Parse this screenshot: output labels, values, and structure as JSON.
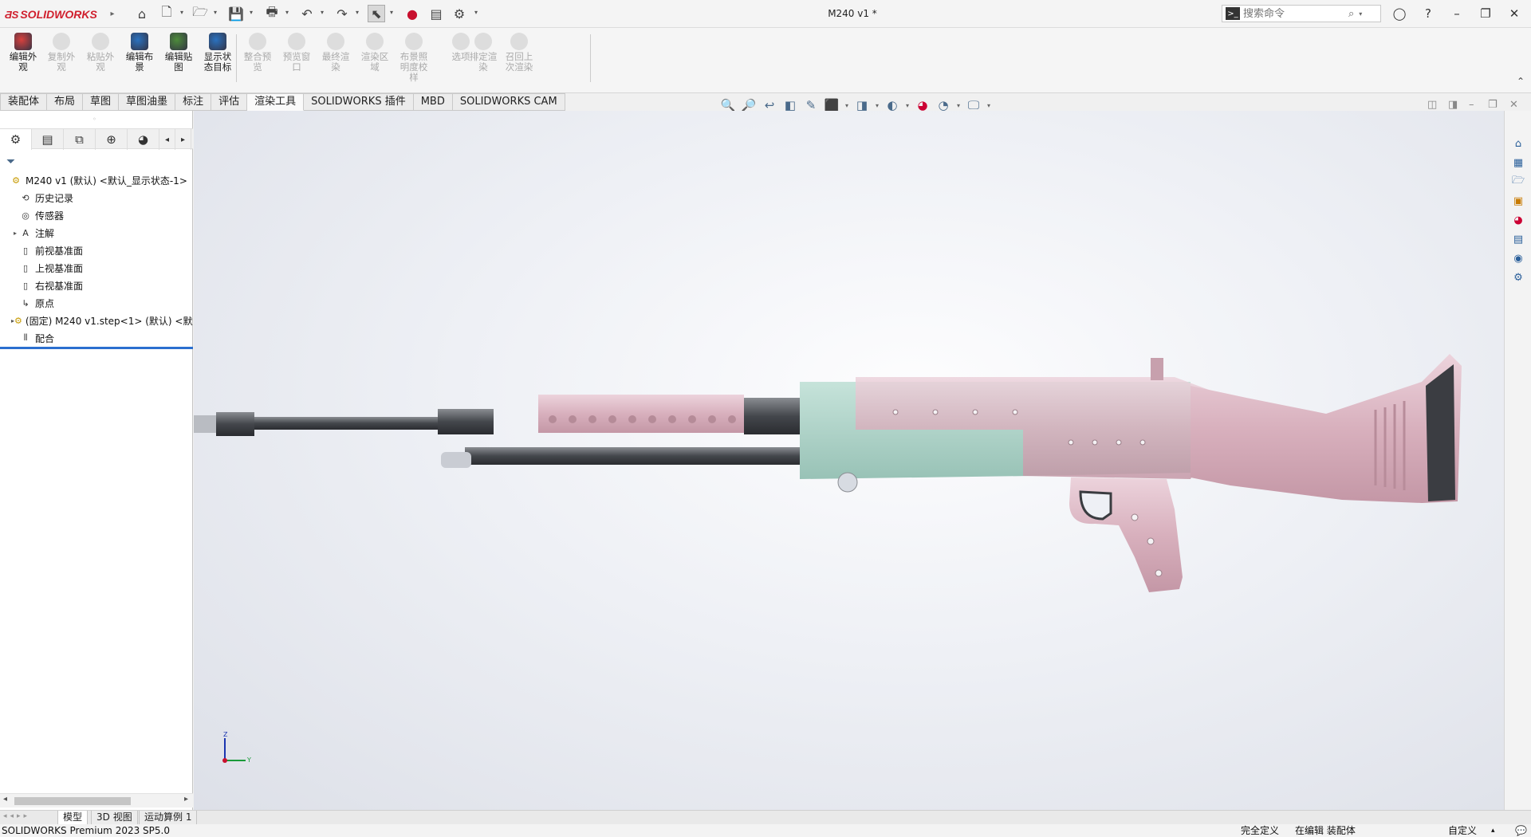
{
  "app": {
    "brand": "SOLIDWORKS",
    "document_title": "M240 v1 *"
  },
  "search": {
    "placeholder": "搜索命令"
  },
  "window_controls": {
    "minimize": "–",
    "restore": "❐",
    "close": "✕"
  },
  "ribbon": {
    "buttons": [
      {
        "label": "编辑外观",
        "enabled": true
      },
      {
        "label": "复制外观",
        "enabled": false
      },
      {
        "label": "粘贴外观",
        "enabled": false
      },
      {
        "label": "编辑布景",
        "enabled": true
      },
      {
        "label": "编辑贴图",
        "enabled": true
      },
      {
        "label": "显示状态目标",
        "enabled": true
      },
      {
        "label": "整合预览",
        "enabled": false
      },
      {
        "label": "预览窗口",
        "enabled": false
      },
      {
        "label": "最终渲染",
        "enabled": false
      },
      {
        "label": "渲染区域",
        "enabled": false
      },
      {
        "label": "布景照明度校样",
        "enabled": false
      },
      {
        "label": "选项",
        "enabled": false
      },
      {
        "label": "排定渲染",
        "enabled": false
      },
      {
        "label": "召回上次渲染",
        "enabled": false
      }
    ]
  },
  "command_tabs": [
    "装配体",
    "布局",
    "草图",
    "草图油墨",
    "标注",
    "评估",
    "渲染工具",
    "SOLIDWORKS 插件",
    "MBD",
    "SOLIDWORKS CAM"
  ],
  "active_tab": "渲染工具",
  "feature_tree": {
    "nodes": [
      {
        "label": "M240 v1 (默认) <默认_显示状态-1>",
        "icon": "assembly-icon",
        "expandable": false,
        "indent": 0
      },
      {
        "label": "历史记录",
        "icon": "history-icon",
        "expandable": false,
        "indent": 1
      },
      {
        "label": "传感器",
        "icon": "sensor-icon",
        "expandable": false,
        "indent": 1
      },
      {
        "label": "注解",
        "icon": "annotation-icon",
        "expandable": true,
        "indent": 1
      },
      {
        "label": "前视基准面",
        "icon": "plane-icon",
        "expandable": false,
        "indent": 1
      },
      {
        "label": "上视基准面",
        "icon": "plane-icon",
        "expandable": false,
        "indent": 1
      },
      {
        "label": "右视基准面",
        "icon": "plane-icon",
        "expandable": false,
        "indent": 1
      },
      {
        "label": "原点",
        "icon": "origin-icon",
        "expandable": false,
        "indent": 1
      },
      {
        "label": "(固定) M240 v1.step<1> (默认) <默认",
        "icon": "part-icon",
        "expandable": true,
        "indent": 1
      },
      {
        "label": "配合",
        "icon": "mates-icon",
        "expandable": false,
        "indent": 1
      }
    ]
  },
  "bottom_tabs": [
    "模型",
    "3D 视图",
    "运动算例 1"
  ],
  "active_bottom_tab": "模型",
  "status_bar": {
    "product": "SOLIDWORKS Premium 2023 SP5.0",
    "definition": "完全定义",
    "editing": "在编辑 装配体",
    "units": "自定义"
  },
  "triad": {
    "z": "Z",
    "y": "Y"
  },
  "colors": {
    "accent": "#d0202e",
    "model_pink": "#dcb4c1",
    "model_green": "#a9cfc3",
    "barrel": "#4a4d52"
  }
}
